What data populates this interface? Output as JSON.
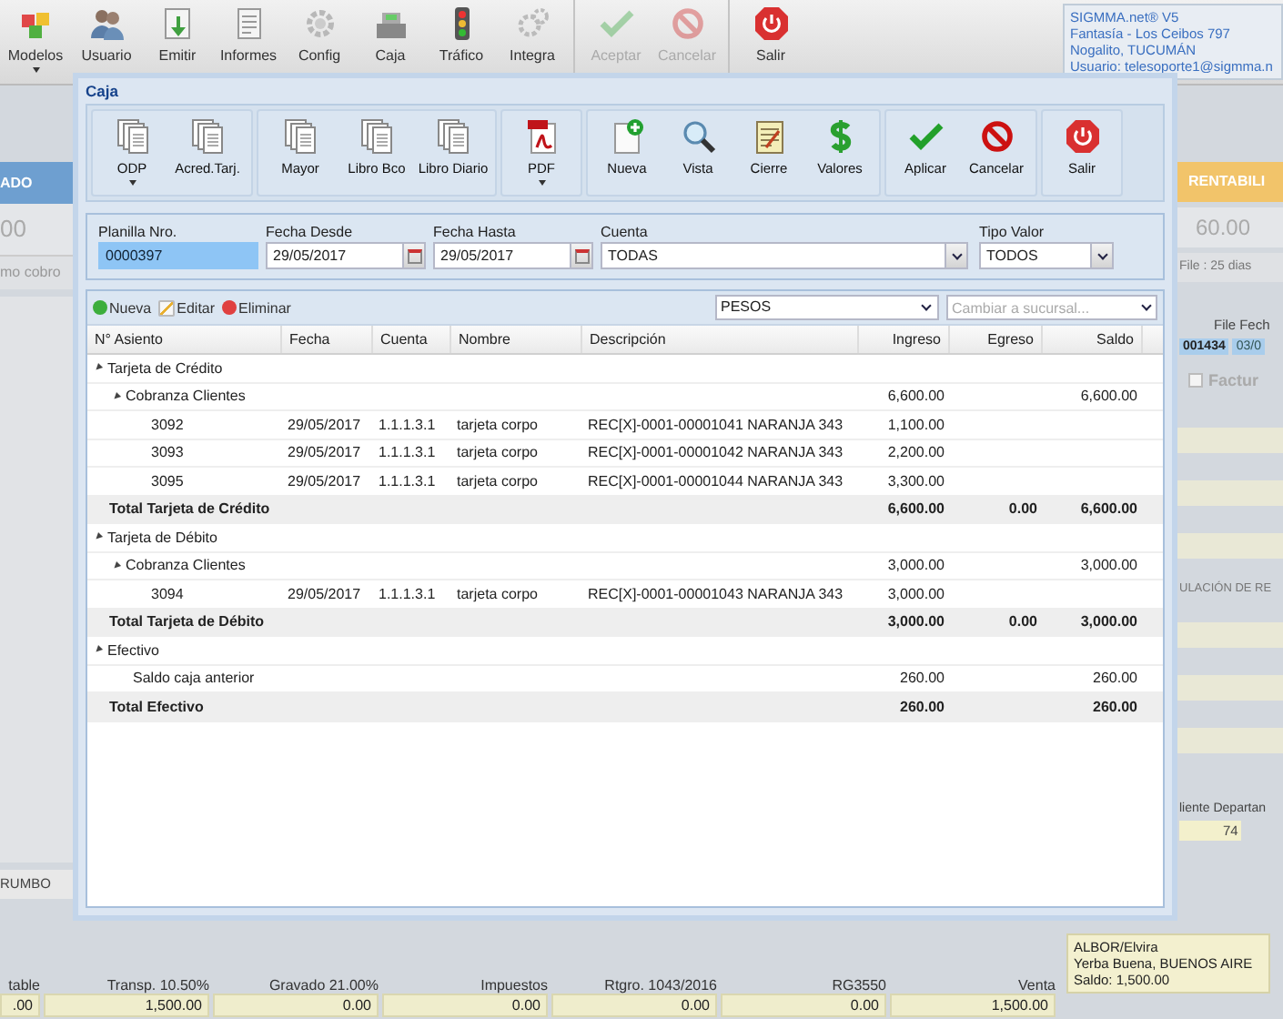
{
  "toolbar": {
    "buttons": [
      {
        "label": "Modelos",
        "dropdown": true,
        "disabled": false
      },
      {
        "label": "Usuario",
        "dropdown": false,
        "disabled": false
      },
      {
        "label": "Emitir",
        "dropdown": false,
        "disabled": false
      },
      {
        "label": "Informes",
        "dropdown": false,
        "disabled": false
      },
      {
        "label": "Config",
        "dropdown": false,
        "disabled": false
      },
      {
        "label": "Caja",
        "dropdown": false,
        "disabled": false
      },
      {
        "label": "Tráfico",
        "dropdown": false,
        "disabled": false
      },
      {
        "label": "Integra",
        "dropdown": false,
        "disabled": false
      },
      {
        "label": "Aceptar",
        "dropdown": false,
        "disabled": true
      },
      {
        "label": "Cancelar",
        "dropdown": false,
        "disabled": true
      },
      {
        "label": "Salir",
        "dropdown": false,
        "disabled": false
      }
    ],
    "info": [
      "SIGMMA.net® V5",
      "Fantasía - Los Ceibos 797",
      "Nogalito, TUCUMÁN",
      "Usuario: telesoporte1@sigmma.n"
    ]
  },
  "left_panel": {
    "header": "ADO",
    "value": "00",
    "note": "mo cobro",
    "field": "RUMBO"
  },
  "right_panel": {
    "header": "RENTABILI",
    "value": "60.00",
    "note": "File : 25 dias",
    "file_label": "File",
    "date_label": "Fech",
    "file_value": "001434",
    "date_value": "03/0",
    "checkbox_label": "Factur",
    "checked": false,
    "section": "ULACIÓN DE RE",
    "client_label": "liente",
    "dept_label": "Departan",
    "client_value": "74"
  },
  "client_box": [
    "ALBOR/Elvira",
    "Yerba Buena, BUENOS AIRE",
    "Saldo: 1,500.00"
  ],
  "totals": [
    {
      "label": "table",
      "value": ".00"
    },
    {
      "label": "Transp. 10.50%",
      "value": "1,500.00"
    },
    {
      "label": "Gravado 21.00%",
      "value": "0.00"
    },
    {
      "label": "Impuestos",
      "value": "0.00"
    },
    {
      "label": "Rtgro. 1043/2016",
      "value": "0.00"
    },
    {
      "label": "RG3550",
      "value": "0.00"
    },
    {
      "label": "Venta",
      "value": "1,500.00"
    }
  ],
  "dialog": {
    "title": "Caja",
    "toolbar": [
      [
        {
          "label": "ODP",
          "dropdown": true
        },
        {
          "label": "Acred.Tarj.",
          "dropdown": false
        }
      ],
      [
        {
          "label": "Mayor",
          "dropdown": false
        },
        {
          "label": "Libro Bco",
          "dropdown": false
        },
        {
          "label": "Libro Diario",
          "dropdown": false
        }
      ],
      [
        {
          "label": "PDF",
          "dropdown": true
        }
      ],
      [
        {
          "label": "Nueva",
          "dropdown": false
        },
        {
          "label": "Vista",
          "dropdown": false
        },
        {
          "label": "Cierre",
          "dropdown": false
        },
        {
          "label": "Valores",
          "dropdown": false
        }
      ],
      [
        {
          "label": "Aplicar",
          "dropdown": false
        },
        {
          "label": "Cancelar",
          "dropdown": false
        }
      ],
      [
        {
          "label": "Salir",
          "dropdown": false
        }
      ]
    ],
    "filters": [
      {
        "kind": "text",
        "label": "Planilla Nro.",
        "value": "0000397",
        "focused": true
      },
      {
        "kind": "date",
        "label": "Fecha Desde",
        "value": "29/05/2017",
        "focused": false
      },
      {
        "kind": "date",
        "label": "Fecha Hasta",
        "value": "29/05/2017",
        "focused": false
      },
      {
        "kind": "select",
        "label": "Cuenta",
        "value": "TODAS",
        "focused": false
      },
      {
        "kind": "select",
        "label": "Tipo Valor",
        "value": "TODOS",
        "focused": false
      }
    ],
    "actions": [
      {
        "label": "Nueva"
      },
      {
        "label": "Editar"
      },
      {
        "label": "Eliminar"
      }
    ],
    "currency": "PESOS",
    "branch": {
      "placeholder": "Cambiar a sucursal..."
    },
    "table": {
      "columns": [
        "N° Asiento",
        "Fecha",
        "Cuenta",
        "Nombre",
        "Descripción",
        "Ingreso",
        "Egreso",
        "Saldo"
      ],
      "rows": [
        {
          "kind": "group",
          "label": "Tarjeta de Crédito",
          "expanded": true,
          "children": [
            {
              "kind": "group",
              "label": "Cobranza Clientes",
              "expanded": true,
              "ingreso": "6,600.00",
              "saldo": "6,600.00",
              "children": [
                {
                  "kind": "entry",
                  "asiento": "3092",
                  "fecha": "29/05/2017",
                  "cuenta": "1.1.1.3.1",
                  "nombre": "tarjeta corpo",
                  "descripcion": "REC[X]-0001-00001041 NARANJA 343",
                  "ingreso": "1,100.00"
                },
                {
                  "kind": "entry",
                  "asiento": "3093",
                  "fecha": "29/05/2017",
                  "cuenta": "1.1.1.3.1",
                  "nombre": "tarjeta corpo",
                  "descripcion": "REC[X]-0001-00001042 NARANJA 343",
                  "ingreso": "2,200.00"
                },
                {
                  "kind": "entry",
                  "asiento": "3095",
                  "fecha": "29/05/2017",
                  "cuenta": "1.1.1.3.1",
                  "nombre": "tarjeta corpo",
                  "descripcion": "REC[X]-0001-00001044 NARANJA 343",
                  "ingreso": "3,300.00"
                }
              ]
            }
          ]
        },
        {
          "kind": "total",
          "label": "Total Tarjeta de Crédito",
          "ingreso": "6,600.00",
          "egreso": "0.00",
          "saldo": "6,600.00"
        },
        {
          "kind": "group",
          "label": "Tarjeta de Débito",
          "expanded": true,
          "children": [
            {
              "kind": "group",
              "label": "Cobranza Clientes",
              "expanded": true,
              "ingreso": "3,000.00",
              "saldo": "3,000.00",
              "children": [
                {
                  "kind": "entry",
                  "asiento": "3094",
                  "fecha": "29/05/2017",
                  "cuenta": "1.1.1.3.1",
                  "nombre": "tarjeta corpo",
                  "descripcion": "REC[X]-0001-00001043 NARANJA 343",
                  "ingreso": "3,000.00"
                }
              ]
            }
          ]
        },
        {
          "kind": "total",
          "label": "Total Tarjeta de Débito",
          "ingreso": "3,000.00",
          "egreso": "0.00",
          "saldo": "3,000.00"
        },
        {
          "kind": "group",
          "label": "Efectivo",
          "expanded": true,
          "children": [
            {
              "kind": "item",
              "label": "Saldo caja anterior",
              "ingreso": "260.00",
              "saldo": "260.00"
            }
          ]
        },
        {
          "kind": "total",
          "label": "Total Efectivo",
          "ingreso": "260.00",
          "saldo": "260.00"
        }
      ]
    }
  }
}
